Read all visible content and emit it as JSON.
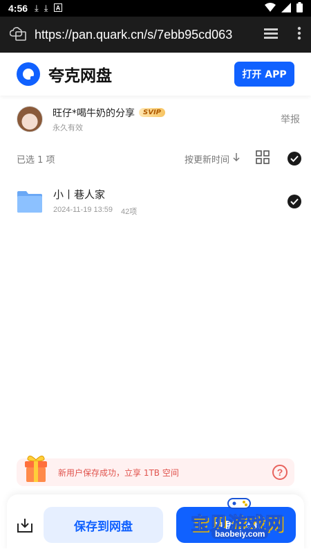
{
  "status_bar": {
    "time": "4:56",
    "icons": [
      "download-icon",
      "download-icon",
      "font-icon",
      "wifi-icon",
      "signal-icon",
      "battery-icon"
    ]
  },
  "browser": {
    "url": "https://pan.quark.cn/s/7ebb95cd063"
  },
  "header": {
    "brand": "夸克网盘",
    "open_app_label": "打开 APP",
    "accent_color": "#1061ff"
  },
  "sharer": {
    "name": "旺仔*喝牛奶的分享",
    "badge": "SVIP",
    "validity": "永久有效",
    "report_label": "举报"
  },
  "toolbar": {
    "selected_label": "已选 1 项",
    "sort_label": "按更新时间"
  },
  "files": [
    {
      "name": "小丨巷人家",
      "date": "2024-11-19 13:59",
      "count": "42项",
      "selected": true
    }
  ],
  "promo": {
    "text": "新用户保存成功，立享 1TB 空间",
    "help_symbol": "?"
  },
  "bottom": {
    "save_label": "保存到网盘",
    "primary_label": "立即查看"
  },
  "watermark": {
    "text": "宝贝游戏网",
    "url": "baobeiy.com"
  }
}
